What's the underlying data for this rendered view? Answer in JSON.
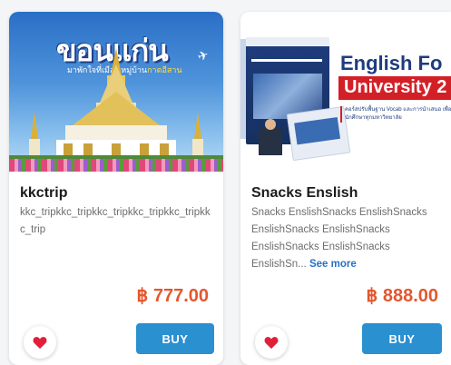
{
  "colors": {
    "price": "#e4572e",
    "buy_button": "#2a90d0",
    "heart": "#e0203a",
    "see_more": "#2a6fc6"
  },
  "products": [
    {
      "thumbnail": {
        "title_text": "ขอนแก่น",
        "subtitle_part1": "มาพักใจที่เมือง",
        "subtitle_part2": "หมู่บ้าน",
        "subtitle_part3": "กาตอีสาน"
      },
      "name": "kkctrip",
      "description": "kkc_tripkkc_tripkkc_tripkkc_tripkkc_tripkkc_trip",
      "see_more": "",
      "price": "฿ 777.00",
      "favorite_icon": "heart-icon",
      "buy_label": "BUY"
    },
    {
      "thumbnail": {
        "title_text": "English Fo",
        "band_text": "University 2",
        "desc_text": "คอร์สปรับพื้นฐาน Vocab และการนำเสนอ เพื่อนักศึกษาทุกมหาวิทยาลัย",
        "book_brand": "CHANGE",
        "book_title": "EXPERIENTIAL ENGLISH 2"
      },
      "name": "Snacks Enslish",
      "description": "Snacks EnslishSnacks EnslishSnacks EnslishSnacks EnslishSnacks EnslishSnacks EnslishSnacks EnslishSn...",
      "see_more": "See more",
      "price": "฿ 888.00",
      "favorite_icon": "heart-icon",
      "buy_label": "BUY"
    }
  ]
}
